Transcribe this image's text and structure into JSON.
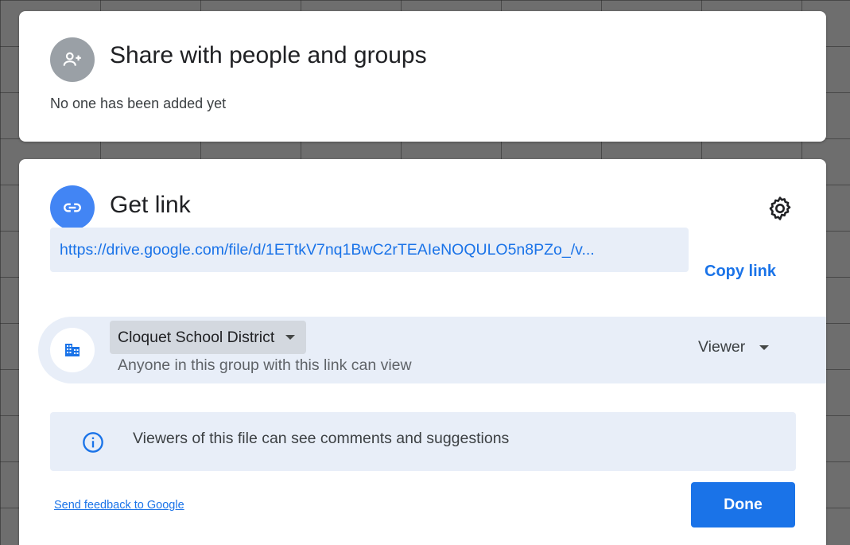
{
  "share": {
    "title": "Share with people and groups",
    "subtitle": "No one has been added yet",
    "icon": "person-add-icon"
  },
  "get_link": {
    "title": "Get link",
    "icon": "link-icon",
    "settings_icon": "gear-icon",
    "url": "https://drive.google.com/file/d/1ETtkV7nq1BwC2rTEAIeNOQULO5n8PZo_/v...",
    "copy_label": "Copy link",
    "access": {
      "icon": "domain-icon",
      "scope": "Cloquet School District",
      "description": "Anyone in this group with this link can view",
      "role": "Viewer"
    },
    "info": {
      "icon": "info-icon",
      "text": "Viewers of this file can see comments and suggestions"
    },
    "feedback_label": "Send feedback to Google",
    "done_label": "Done"
  },
  "colors": {
    "accent": "#1a73e8",
    "link_circle": "#4285f4",
    "share_circle": "#9aa0a6",
    "panel_tint": "#e8eef8"
  }
}
